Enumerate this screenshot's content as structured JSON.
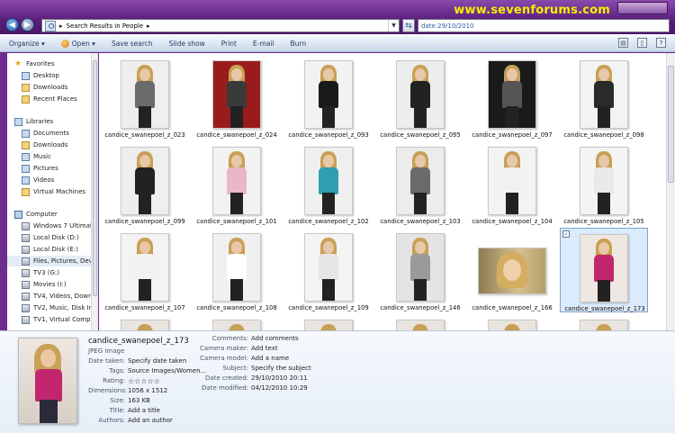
{
  "watermark": "www.sevenforums.com",
  "address": {
    "separator": "▸",
    "text": "Search Results in People",
    "trail": "▸"
  },
  "search": {
    "value": "date:29/10/2010"
  },
  "toolbar": {
    "organize": "Organize ▾",
    "open": "Open ▾",
    "save_search": "Save search",
    "slide_show": "Slide show",
    "print": "Print",
    "email": "E-mail",
    "burn": "Burn"
  },
  "nav": {
    "favorites": "Favorites",
    "desktop": "Desktop",
    "downloads": "Downloads",
    "recent_places": "Recent Places",
    "libraries": "Libraries",
    "documents": "Documents",
    "lib_downloads": "Downloads",
    "music": "Music",
    "pictures": "Pictures",
    "videos": "Videos",
    "virtual_machines": "Virtual Machines",
    "computer": "Computer",
    "drives": [
      "Windows 7 Ultimate",
      "Local Disk (D:)",
      "Local Disk (E:)",
      "Files, Pictures, Dev (",
      "TV3 (G:)",
      "Movies (I:)",
      "TV4, Videos, Downlo",
      "TV2, Music, Disk Im",
      "TV1, Virtual Compu"
    ]
  },
  "files": [
    "candice_swanepoel_z_023",
    "candice_swanepoel_z_024",
    "candice_swanepoel_z_093",
    "candice_swanepoel_z_095",
    "candice_swanepoel_z_097",
    "candice_swanepoel_z_098",
    "candice_swanepoel_z_099",
    "candice_swanepoel_z_101",
    "candice_swanepoel_z_102",
    "candice_swanepoel_z_103",
    "candice_swanepoel_z_104",
    "candice_swanepoel_z_105",
    "candice_swanepoel_z_107",
    "candice_swanepoel_z_108",
    "candice_swanepoel_z_109",
    "candice_swanepoel_z_146",
    "candice_swanepoel_z_166",
    "candice_swanepoel_z_173"
  ],
  "details": {
    "name": "candice_swanepoel_z_173",
    "type": "JPEG Image",
    "date_taken_label": "Date taken:",
    "date_taken": "Specify date taken",
    "tags_label": "Tags:",
    "tags": "Source Images/Women...",
    "rating_label": "Rating:",
    "rating": 0,
    "dimensions_label": "Dimensions:",
    "dimensions": "1056 x 1512",
    "size_label": "Size:",
    "size": "163 KB",
    "title_label": "Title:",
    "title": "Add a title",
    "authors_label": "Authors:",
    "authors": "Add an author",
    "comments_label": "Comments:",
    "comments": "Add comments",
    "camera_maker_label": "Camera maker:",
    "camera_maker": "Add text",
    "camera_model_label": "Camera model:",
    "camera_model": "Add a name",
    "subject_label": "Subject:",
    "subject": "Specify the subject",
    "date_created_label": "Date created:",
    "date_created": "29/10/2010 20:11",
    "date_modified_label": "Date modified:",
    "date_modified": "04/12/2010 10:29"
  }
}
